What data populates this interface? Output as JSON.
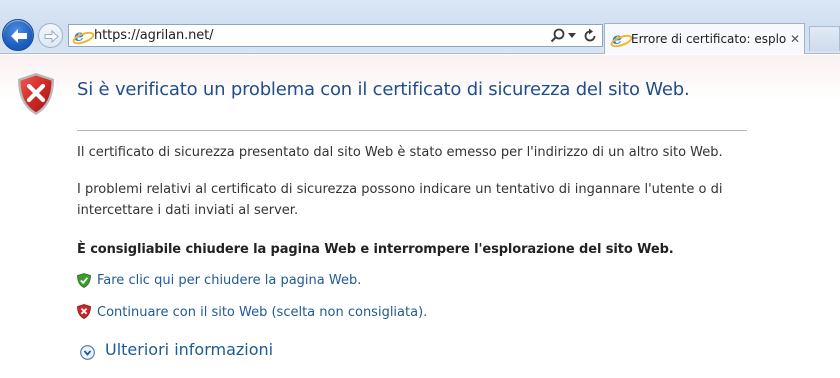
{
  "browser": {
    "url": "https://agrilan.net/",
    "tab_title": "Errore di certificato: esplora...",
    "tab_close": "✕"
  },
  "icons": {
    "back": "back-arrow-icon",
    "forward": "forward-arrow-icon",
    "site": "internet-explorer-icon",
    "search": "search-icon",
    "refresh": "refresh-icon",
    "error_shield": "shield-error-icon",
    "safe_shield": "shield-check-icon",
    "expand": "chevron-down-icon"
  },
  "colors": {
    "title": "#1f4e8c",
    "link": "#1f5a94",
    "error_red": "#c7282b",
    "safe_green": "#3f9a2e"
  },
  "page": {
    "title": "Si è verificato un problema con il certificato di sicurezza del sito Web.",
    "paragraph1": "Il certificato di sicurezza presentato dal sito Web è stato emesso per l'indirizzo di un altro sito Web.",
    "paragraph2": "I problemi relativi al certificato di sicurezza possono indicare un tentativo di ingannare l'utente o di intercettare i dati inviati al server.",
    "recommendation": "È consigliabile chiudere la pagina Web e interrompere l'esplorazione del sito Web.",
    "option_close": "Fare clic qui per chiudere la pagina Web.",
    "option_continue": "Continuare con il sito Web (scelta non consigliata).",
    "more_info": "Ulteriori informazioni"
  }
}
